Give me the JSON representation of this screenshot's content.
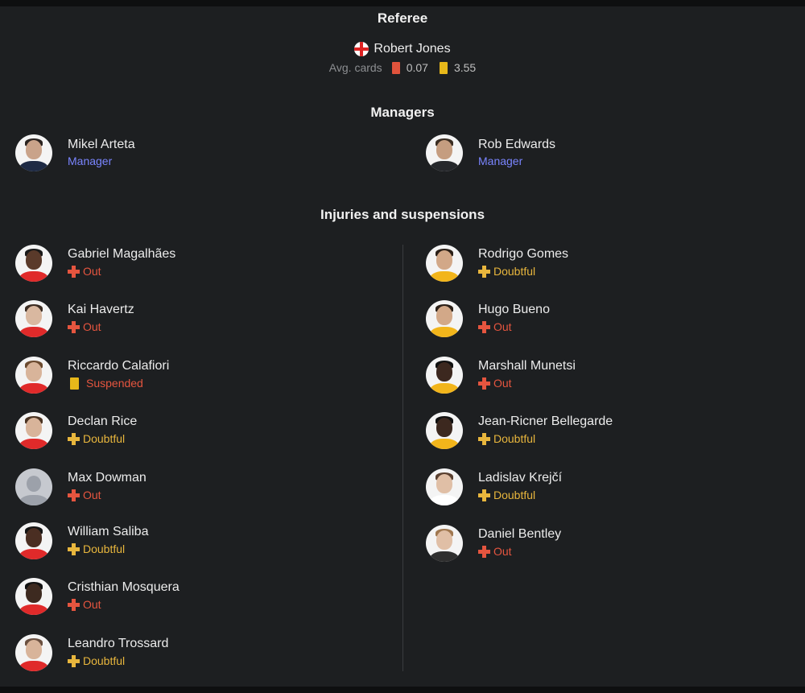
{
  "referee": {
    "title": "Referee",
    "name": "Robert Jones",
    "avg_label": "Avg. cards",
    "red_avg": "0.07",
    "yellow_avg": "3.55",
    "flag_icon": "england-flag-icon"
  },
  "managers": {
    "title": "Managers",
    "home": {
      "name": "Mikel Arteta",
      "role": "Manager"
    },
    "away": {
      "name": "Rob Edwards",
      "role": "Manager"
    }
  },
  "injuries": {
    "title": "Injuries and suspensions",
    "home": [
      {
        "name": "Gabriel Magalhães",
        "status": "Out"
      },
      {
        "name": "Kai Havertz",
        "status": "Out"
      },
      {
        "name": "Riccardo Calafiori",
        "status": "Suspended"
      },
      {
        "name": "Declan Rice",
        "status": "Doubtful"
      },
      {
        "name": "Max Dowman",
        "status": "Out"
      },
      {
        "name": "William Saliba",
        "status": "Doubtful"
      },
      {
        "name": "Cristhian Mosquera",
        "status": "Out"
      },
      {
        "name": "Leandro Trossard",
        "status": "Doubtful"
      }
    ],
    "away": [
      {
        "name": "Rodrigo Gomes",
        "status": "Doubtful"
      },
      {
        "name": "Hugo Bueno",
        "status": "Out"
      },
      {
        "name": "Marshall Munetsi",
        "status": "Out"
      },
      {
        "name": "Jean-Ricner Bellegarde",
        "status": "Doubtful"
      },
      {
        "name": "Ladislav Krejčí",
        "status": "Doubtful"
      },
      {
        "name": "Daniel Bentley",
        "status": "Out"
      }
    ]
  },
  "colors": {
    "out": "#e5553f",
    "doubtful": "#e8b63d",
    "manager_role": "#7a85ff",
    "red_card": "#e0533c",
    "yellow_card": "#e7b81a"
  }
}
